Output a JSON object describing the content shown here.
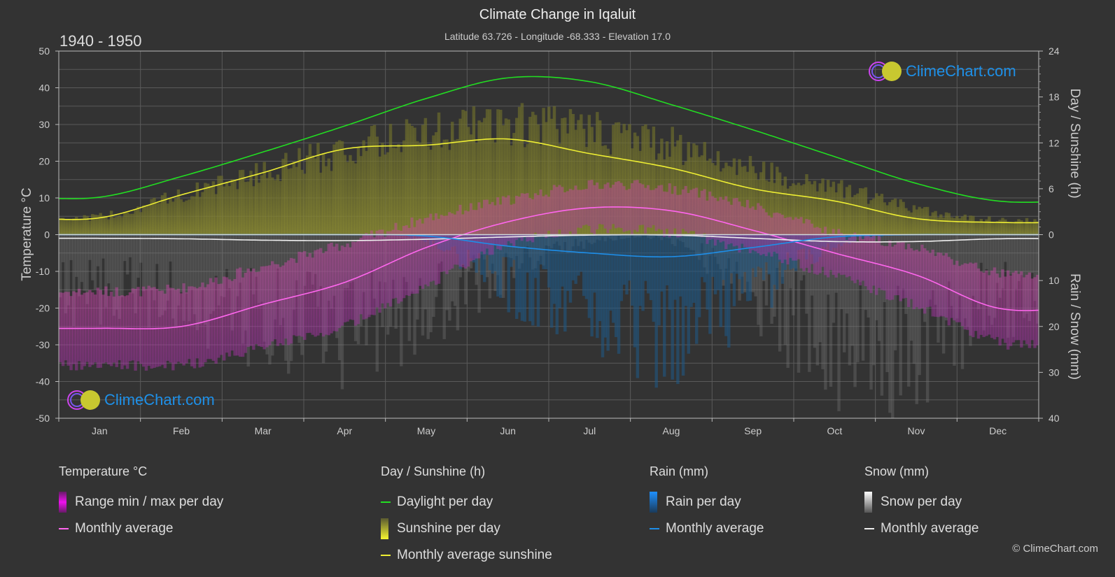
{
  "header": {
    "title": "Climate Change in Iqaluit",
    "subtitle": "Latitude 63.726 - Longitude -68.333 - Elevation 17.0",
    "period": "1940 - 1950"
  },
  "brand": {
    "name": "ClimeChart.com",
    "copyright": "© ClimeChart.com"
  },
  "legend": {
    "temperature": {
      "title": "Temperature °C",
      "range": "Range min / max per day",
      "avg": "Monthly average"
    },
    "sunshine": {
      "title": "Day / Sunshine (h)",
      "daylight": "Daylight per day",
      "sunshine": "Sunshine per day",
      "avg": "Monthly average sunshine"
    },
    "rain": {
      "title": "Rain (mm)",
      "per_day": "Rain per day",
      "avg": "Monthly average"
    },
    "snow": {
      "title": "Snow (mm)",
      "per_day": "Snow per day",
      "avg": "Monthly average"
    }
  },
  "colors": {
    "temp_avg": "#ff66ee",
    "temp_range": "#cc33cc",
    "daylight": "#22dd22",
    "sunshine_avg": "#eeee33",
    "sunshine_fill": "#8a8a30",
    "rain_avg": "#1e8ee8",
    "rain_fill": "#1e5a88",
    "snow_avg": "#eeeeee",
    "snow_fill": "#777777"
  },
  "chart_data": {
    "type": "line",
    "title": "Climate Change in Iqaluit",
    "categories": [
      "Jan",
      "Feb",
      "Mar",
      "Apr",
      "May",
      "Jun",
      "Jul",
      "Aug",
      "Sep",
      "Oct",
      "Nov",
      "Dec"
    ],
    "left_axis": {
      "label": "Temperature °C",
      "range": [
        -50,
        50
      ],
      "ticks": [
        "50",
        "40",
        "30",
        "20",
        "10",
        "0",
        "-10",
        "-20",
        "-30",
        "-40",
        "-50"
      ]
    },
    "right_axis_top": {
      "label": "Day / Sunshine (h)",
      "range": [
        0,
        24
      ],
      "ticks": [
        "24",
        "18",
        "12",
        "6",
        "0"
      ]
    },
    "right_axis_bottom": {
      "label": "Rain / Snow (mm)",
      "range": [
        0,
        40
      ],
      "ticks": [
        "0",
        "10",
        "20",
        "30",
        "40"
      ]
    },
    "grid": true,
    "series": [
      {
        "name": "Temperature monthly average (°C)",
        "axis": "temp",
        "values": [
          -25.5,
          -25.0,
          -19.0,
          -13.0,
          -3.5,
          3.5,
          7.3,
          6.5,
          1.2,
          -5.0,
          -11.0,
          -20.0
        ]
      },
      {
        "name": "Temperature daily min (°C)",
        "axis": "temp",
        "values": [
          -34,
          -34,
          -29,
          -23,
          -12,
          -1,
          3,
          2,
          -3,
          -10,
          -18,
          -28
        ]
      },
      {
        "name": "Temperature daily max (°C)",
        "axis": "temp",
        "values": [
          -17,
          -16,
          -10,
          -4,
          3,
          8,
          12,
          11,
          6,
          -1,
          -5,
          -12
        ]
      },
      {
        "name": "Daylight per day (h)",
        "axis": "hours",
        "values": [
          4.9,
          7.6,
          10.8,
          14.2,
          17.8,
          20.5,
          20.0,
          17.0,
          13.7,
          10.2,
          6.7,
          4.4
        ]
      },
      {
        "name": "Sunshine per day (h)",
        "axis": "hours",
        "values": [
          2.5,
          5.5,
          8.6,
          11.6,
          14.0,
          15.0,
          14.3,
          12.3,
          9.0,
          6.5,
          3.5,
          2.0
        ]
      },
      {
        "name": "Monthly average sunshine (h)",
        "axis": "hours",
        "values": [
          2.2,
          5.2,
          8.1,
          11.2,
          11.7,
          12.5,
          10.6,
          8.7,
          6.0,
          4.4,
          2.1,
          1.6
        ]
      },
      {
        "name": "Rain monthly average (mm)",
        "axis": "precip",
        "values": [
          0.0,
          0.0,
          0.0,
          0.0,
          0.3,
          2.5,
          4.0,
          4.8,
          2.8,
          0.5,
          0.0,
          0.0
        ]
      },
      {
        "name": "Snow monthly average (mm)",
        "axis": "precip",
        "values": [
          0.8,
          0.9,
          1.2,
          1.3,
          1.0,
          0.5,
          0.1,
          0.1,
          0.8,
          1.5,
          1.5,
          0.9
        ]
      }
    ]
  }
}
